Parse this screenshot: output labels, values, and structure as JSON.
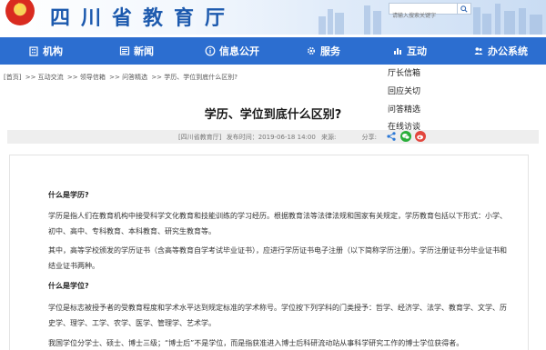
{
  "header": {
    "site_title": "四川省教育厅",
    "search_placeholder": "请输入搜索关键字"
  },
  "nav": {
    "items": [
      {
        "label": "机构",
        "icon": "building-icon"
      },
      {
        "label": "新闻",
        "icon": "newspaper-icon"
      },
      {
        "label": "信息公开",
        "icon": "info-icon"
      },
      {
        "label": "服务",
        "icon": "gear-icon"
      },
      {
        "label": "互动",
        "icon": "chart-icon"
      },
      {
        "label": "办公系统",
        "icon": "users-icon"
      }
    ]
  },
  "dropdown": {
    "items": [
      "厅长信箱",
      "回应关切",
      "问答精选",
      "在线访谈"
    ]
  },
  "breadcrumb": {
    "items": [
      "[首页]",
      ">> 互动交流",
      ">> 领导信箱",
      ">> 问答精选",
      ">> 学历、学位到底什么区别?"
    ]
  },
  "article": {
    "title": "学历、学位到底什么区别?",
    "source": "[四川省教育厅]",
    "published_label": "发布时间：",
    "published_time": "2019-06-18 14:00",
    "from_label": "来源:",
    "share_label": "分享:",
    "share_colors": {
      "share": "#2b78d6",
      "wechat": "#2aae3a",
      "weibo": "#e2463d"
    },
    "h1": "什么是学历?",
    "p1": "学历是指人们在教育机构中接受科学文化教育和技能训练的学习经历。根据教育法等法律法规和国家有关规定，学历教育包括以下形式：小学、初中、高中、专科教育、本科教育、研究生教育等。",
    "p2": "其中，高等学校颁发的学历证书（含高等教育自学考试毕业证书），应进行学历证书电子注册（以下简称学历注册）。学历注册证书分毕业证书和结业证书两种。",
    "h2": "什么是学位?",
    "p3": "学位是标志被授予者的受教育程度和学术水平达到规定标准的学术称号。学位按下列学科的门类授予：哲学、经济学、法学、教育学、文学、历史学、理学、工学、农学、医学、管理学、艺术学。",
    "p4": "我国学位分学士、硕士、博士三级；“博士后”不是学位，而是指获准进入博士后科研流动站从事科学研究工作的博士学位获得者。"
  },
  "colors": {
    "nav_bg": "#2c6ed0",
    "title_blue": "#1d5aae"
  }
}
